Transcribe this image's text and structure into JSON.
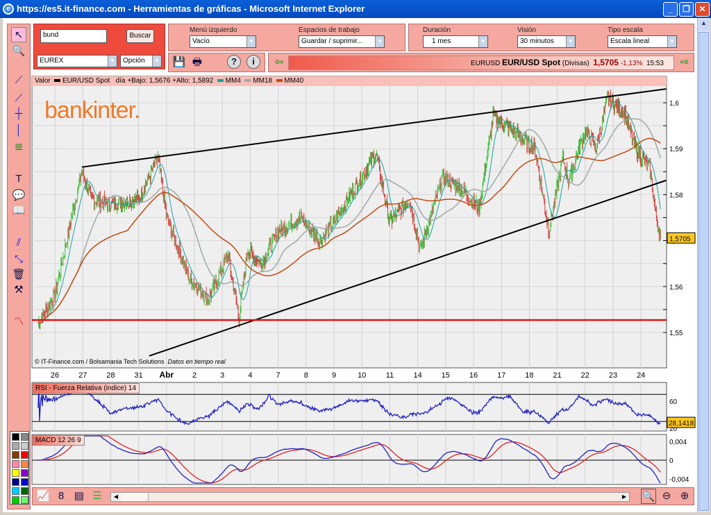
{
  "window": {
    "title": "https://es5.it-finance.com - Herramientas de gráficas - Microsoft Internet Explorer"
  },
  "search": {
    "value": "bund",
    "button": "Buscar",
    "market": "EUREX",
    "type": "Opción"
  },
  "menu": {
    "left_label": "Menú izquierdo",
    "left_value": "Vacío",
    "workspace_label": "Espacios de trabajo",
    "workspace_value": "Guardar / suprimir..."
  },
  "settings": {
    "duration_label": "Duración",
    "duration_value": "1 mes",
    "vision_label": "Visión",
    "vision_value": "30 minutos",
    "scale_label": "Tipo escala",
    "scale_value": "Escala lineal"
  },
  "ticker": {
    "code": "EURUSD",
    "name": "EUR/USD Spot",
    "type": "(Divisas)",
    "price": "1,5705",
    "change": "-1,13%",
    "time": "15:53"
  },
  "legend": {
    "valor": "Valor",
    "series": "EUR/USD Spot",
    "range": "día +Bajo: 1,5676 +Alto: 1,5892",
    "mm4": "MM4",
    "mm18": "MM18",
    "mm40": "MM40"
  },
  "logo": "bankinter.",
  "credits": {
    "source": "© IT-Finance.com / Bolsamania Tech Solutions",
    "realtime": "Datos en tiempo real"
  },
  "colors": {
    "mm4": "#1aa0a0",
    "mm18": "#a0a8a8",
    "mm40": "#c04a10",
    "up": "#40c040",
    "down": "#d04040",
    "rsi": "#2020c0",
    "signal": "#e02020",
    "support": "#e01010"
  },
  "chart_data": {
    "type": "line",
    "title": "EUR/USD Spot",
    "x_tick_labels": [
      "26",
      "27",
      "28",
      "31",
      "Abr",
      "2",
      "3",
      "4",
      "7",
      "8",
      "9",
      "10",
      "11",
      "14",
      "15",
      "16",
      "17",
      "18",
      "21",
      "22",
      "23",
      "24"
    ],
    "y_ticks": [
      1.55,
      1.56,
      1.57,
      1.58,
      1.59,
      1.6
    ],
    "y_tick_labels": [
      "1,55",
      "1,56",
      "1,57",
      "1,58",
      "1,59",
      "1,6"
    ],
    "ylim": [
      1.5445,
      1.6055
    ],
    "last_label": "1,5705",
    "last_value": 1.5705,
    "price_keypoints": [
      [
        -0.6,
        1.552
      ],
      [
        0.0,
        1.558
      ],
      [
        0.6,
        1.575
      ],
      [
        0.97,
        1.585
      ],
      [
        1.3,
        1.579
      ],
      [
        2,
        1.578
      ],
      [
        3,
        1.579
      ],
      [
        3.7,
        1.588
      ],
      [
        4,
        1.575
      ],
      [
        4.8,
        1.562
      ],
      [
        5.5,
        1.557
      ],
      [
        6.2,
        1.567
      ],
      [
        6.6,
        1.553
      ],
      [
        6.9,
        1.568
      ],
      [
        7.4,
        1.565
      ],
      [
        8,
        1.572
      ],
      [
        8.8,
        1.575
      ],
      [
        9.5,
        1.57
      ],
      [
        10,
        1.574
      ],
      [
        10.9,
        1.583
      ],
      [
        11.5,
        1.589
      ],
      [
        12,
        1.574
      ],
      [
        12.7,
        1.579
      ],
      [
        13.1,
        1.568
      ],
      [
        13.9,
        1.584
      ],
      [
        14.6,
        1.581
      ],
      [
        15.2,
        1.577
      ],
      [
        15.7,
        1.597
      ],
      [
        16.4,
        1.594
      ],
      [
        17.2,
        1.59
      ],
      [
        17.7,
        1.572
      ],
      [
        18.2,
        1.588
      ],
      [
        18.4,
        1.583
      ],
      [
        19,
        1.594
      ],
      [
        19.4,
        1.59
      ],
      [
        19.8,
        1.601
      ],
      [
        20.4,
        1.598
      ],
      [
        20.8,
        1.59
      ],
      [
        21.3,
        1.586
      ],
      [
        21.55,
        1.575
      ],
      [
        21.7,
        1.5705
      ]
    ],
    "trendlines": [
      {
        "name": "upper",
        "from": [
          0.97,
          1.586
        ],
        "to": [
          21.9,
          1.603
        ],
        "color": "#000000"
      },
      {
        "name": "lower",
        "from": [
          3.38,
          1.5449
        ],
        "to": [
          21.9,
          1.5831
        ],
        "color": "#000000"
      }
    ],
    "support_level": 1.5527,
    "rsi": {
      "label": "RSI - Fuerza Relativa (indice) 14",
      "period": 14,
      "ticks": [
        "60",
        "20"
      ],
      "levels": [
        70,
        30
      ],
      "last_label": "28,1418"
    },
    "macd": {
      "label": "MACD 12 26 9",
      "ticks": [
        "0,004",
        "0",
        "-0,004"
      ],
      "params": [
        12,
        26,
        9
      ]
    }
  }
}
